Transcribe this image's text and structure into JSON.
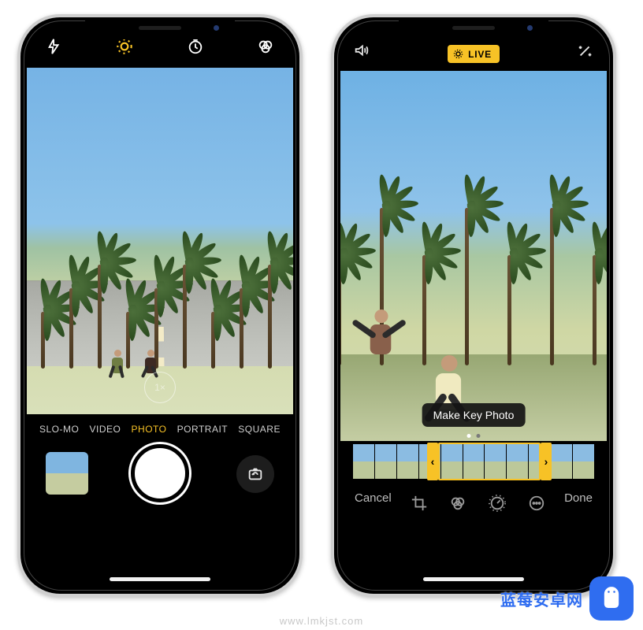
{
  "camera": {
    "zoom_label": "1×",
    "modes": [
      "SLO-MO",
      "VIDEO",
      "PHOTO",
      "PORTRAIT",
      "SQUARE"
    ],
    "active_mode_index": 2,
    "icons": {
      "flash": "flash-icon",
      "live": "live-photo-icon",
      "timer": "timer-icon",
      "filters": "filters-icon",
      "flip": "camera-flip-icon"
    }
  },
  "edit": {
    "live_label": "LIVE",
    "key_photo_label": "Make Key Photo",
    "cancel_label": "Cancel",
    "done_label": "Done",
    "icons": {
      "sound": "sound-icon",
      "wand": "magic-wand-icon",
      "crop": "crop-icon",
      "filters": "filters-icon",
      "adjust": "adjust-dial-icon",
      "more": "more-icon"
    }
  },
  "watermark": {
    "brand_text": "蓝莓安卓网",
    "url": "www.lmkjst.com"
  },
  "colors": {
    "accent": "#f7c226",
    "brand_blue": "#2f6df0"
  }
}
